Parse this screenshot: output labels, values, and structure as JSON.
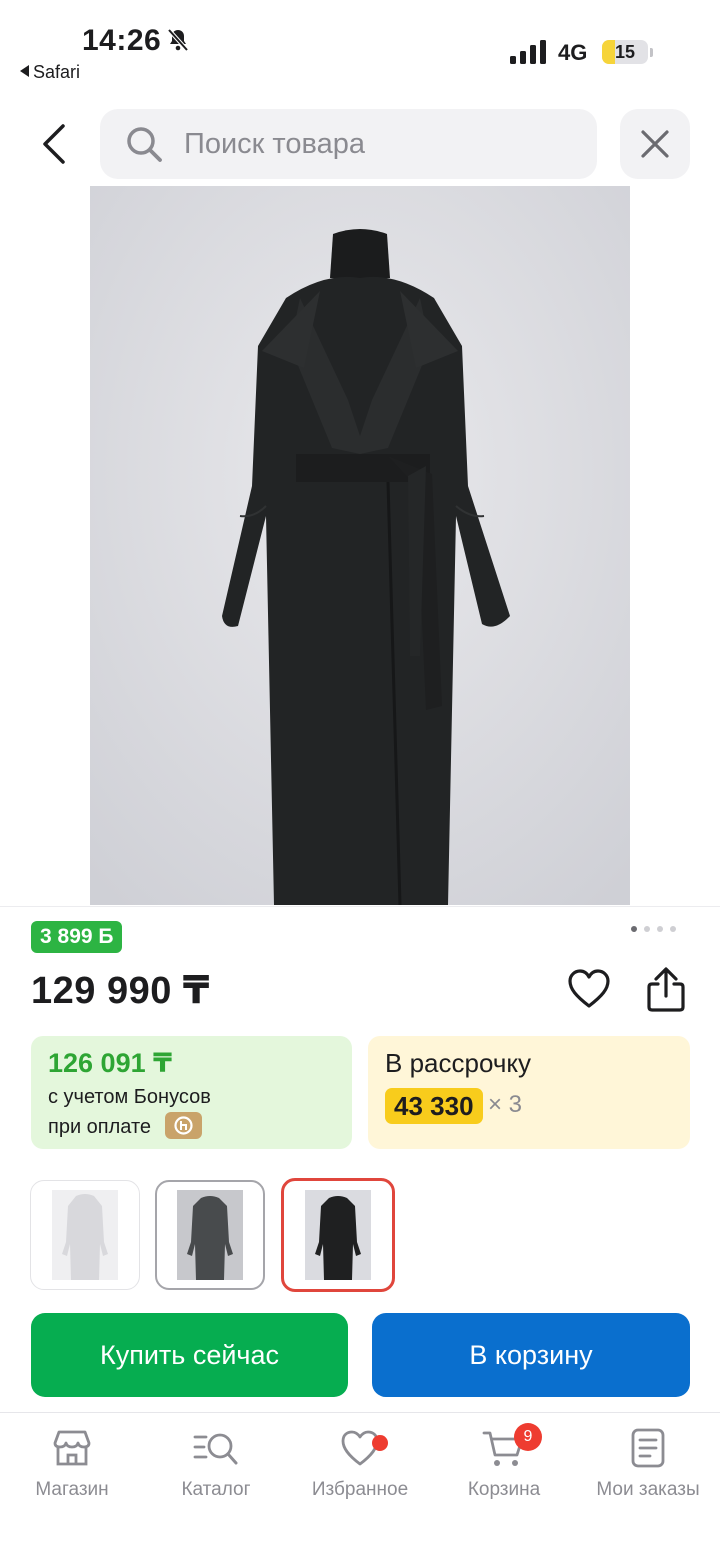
{
  "status": {
    "time": "14:26",
    "back_app": "Safari",
    "network": "4G",
    "battery": "15",
    "battery_level": 0.15
  },
  "search": {
    "placeholder": "Поиск товара",
    "value": ""
  },
  "icons": {
    "back": "chevron-left-icon",
    "search": "search-icon",
    "close": "close-icon",
    "favorite": "heart-icon",
    "share": "share-icon"
  },
  "colors": {
    "bonus_green": "#2db443",
    "buy_green": "#06ad50",
    "cart_blue": "#0a6fce",
    "installment_yellow": "#f8cc1c",
    "selected_thumb": "#e0463c",
    "badge_red": "#ee3c30"
  },
  "product": {
    "bonus_badge": "3 899 Б",
    "price": "129 990 ₸",
    "gallery_count": 4,
    "gallery_active": 0
  },
  "bonus_card": {
    "amount": "126 091 ₸",
    "line1": "с учетом Бонусов",
    "line2": "при оплате"
  },
  "installment_card": {
    "title": "В рассрочку",
    "amount": "43 330",
    "multiplier": "× 3"
  },
  "actions": {
    "buy_now": "Купить сейчас",
    "add_to_cart": "В корзину"
  },
  "tabs": [
    {
      "label": "Магазин",
      "icon": "store-icon"
    },
    {
      "label": "Каталог",
      "icon": "catalog-search-icon"
    },
    {
      "label": "Избранное",
      "icon": "heart-icon",
      "dot": true
    },
    {
      "label": "Корзина",
      "icon": "cart-icon",
      "badge": "9"
    },
    {
      "label": "Мои заказы",
      "icon": "orders-icon"
    }
  ]
}
